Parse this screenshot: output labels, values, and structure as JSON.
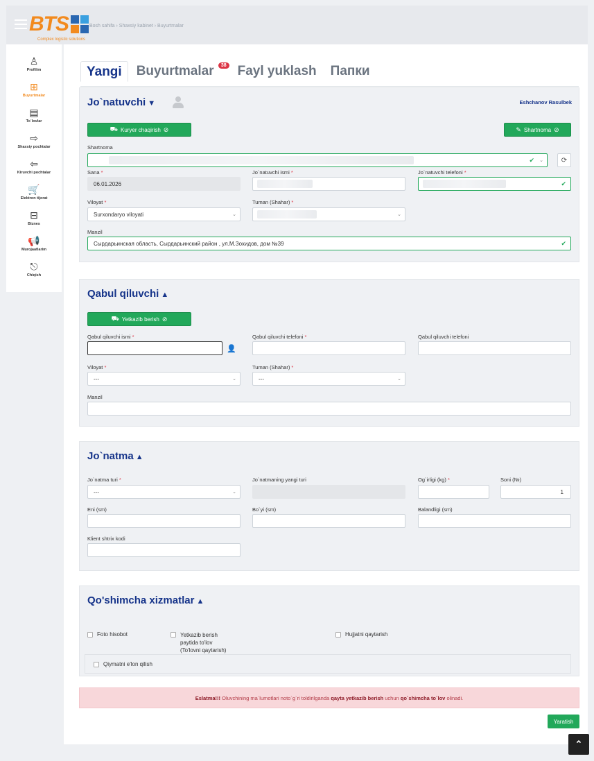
{
  "header": {
    "logo_text": "BTS",
    "logo_tagline": "Complex logistic solutions",
    "breadcrumb": "Bosh sahifa › Shaxsiy kabinet › Buyurtmalar"
  },
  "sidebar": {
    "items": [
      {
        "label": "Profilim",
        "icon": "user-icon",
        "glyph": "♙"
      },
      {
        "label": "Buyurtmalar",
        "icon": "plus-square-icon",
        "glyph": "⊞"
      },
      {
        "label": "To`lovlar",
        "icon": "money-icon",
        "glyph": "▤"
      },
      {
        "label": "Shaxsiy pochtalar",
        "icon": "outbox-icon",
        "glyph": "⇨"
      },
      {
        "label": "Kiruvchi pochtalar",
        "icon": "inbox-icon",
        "glyph": "⇦"
      },
      {
        "label": "Elektron tijorat",
        "icon": "cart-icon",
        "glyph": "🛒"
      },
      {
        "label": "Biznes",
        "icon": "briefcase-icon",
        "glyph": "⊟"
      },
      {
        "label": "Murojaatlarim",
        "icon": "megaphone-icon",
        "glyph": "📢"
      },
      {
        "label": "Chiqish",
        "icon": "logout-icon",
        "glyph": "⎋"
      }
    ]
  },
  "tabs": [
    {
      "label": "Yangi"
    },
    {
      "label": "Buyurtmalar",
      "badge": "38"
    },
    {
      "label": "Fayl yuklash"
    },
    {
      "label": "Папки"
    }
  ],
  "sender": {
    "title": "Jo`natuvchi",
    "name": "Eshchanov Rasulbek",
    "courier_button": "Kuryer chaqirish",
    "contract_button": "Shartnoma",
    "contract_label": "Shartnoma",
    "date_label": "Sana",
    "date_value": "06.01.2026",
    "name_label": "Jo`natuvchi ismi",
    "phone_label": "Jo`natuvchi telefoni",
    "region_label": "Viloyat",
    "region_value": "Surxondaryo viloyati",
    "district_label": "Tuman (Shahar)",
    "address_label": "Manzil",
    "address_value": "Сырдарьинская область, Сырдарьинский район , ул.М.Зохидов, дом №39"
  },
  "receiver": {
    "title": "Qabul qiluvchi",
    "delivery_button": "Yetkazib berish",
    "name_label": "Qabul qiluvchi ismi",
    "phone_label": "Qabul qiluvchi telefoni",
    "phone2_label": "Qabul qiluvchi telefoni",
    "region_label": "Viloyat",
    "region_value": "---",
    "district_label": "Tuman (Shahar)",
    "district_value": "---",
    "address_label": "Manzil"
  },
  "parcel": {
    "title": "Jo`natma",
    "type_label": "Jo`natma turi",
    "type_value": "---",
    "new_type_label": "Jo`natmaning yangi turi",
    "weight_label": "Og`irligi (kg)",
    "count_label": "Soni (№)",
    "count_value": "1",
    "width_label": "Eni (sm)",
    "length_label": "Bo`yi (sm)",
    "height_label": "Balandligi (sm)",
    "barcode_label": "Klient shtrix kodi"
  },
  "extras": {
    "title": "Qo'shimcha xizmatlar",
    "photo_report": "Foto hisobot",
    "cod_line1": "Yetkazib berish",
    "cod_line2": "paytida to'lov",
    "cod_line3": "(To'lovni qaytarish)",
    "doc_return": "Hujjatni qaytarish",
    "declare_value": "Qiymatni e'lon qilish"
  },
  "alert": {
    "prefix": "Eslatma!!!",
    "text1": " Oluvchining ma`lumotlari noto`g`ri toldirilganda ",
    "bold1": "qayta yetkazib berish",
    "text2": " uchun ",
    "bold2": "qo`shimcha to`lov",
    "text3": " olinadi."
  },
  "create_button": "Yaratish",
  "colors": {
    "brand": "#f28a1e",
    "accent": "#16348a",
    "success": "#22a85a",
    "danger": "#dc3545"
  }
}
